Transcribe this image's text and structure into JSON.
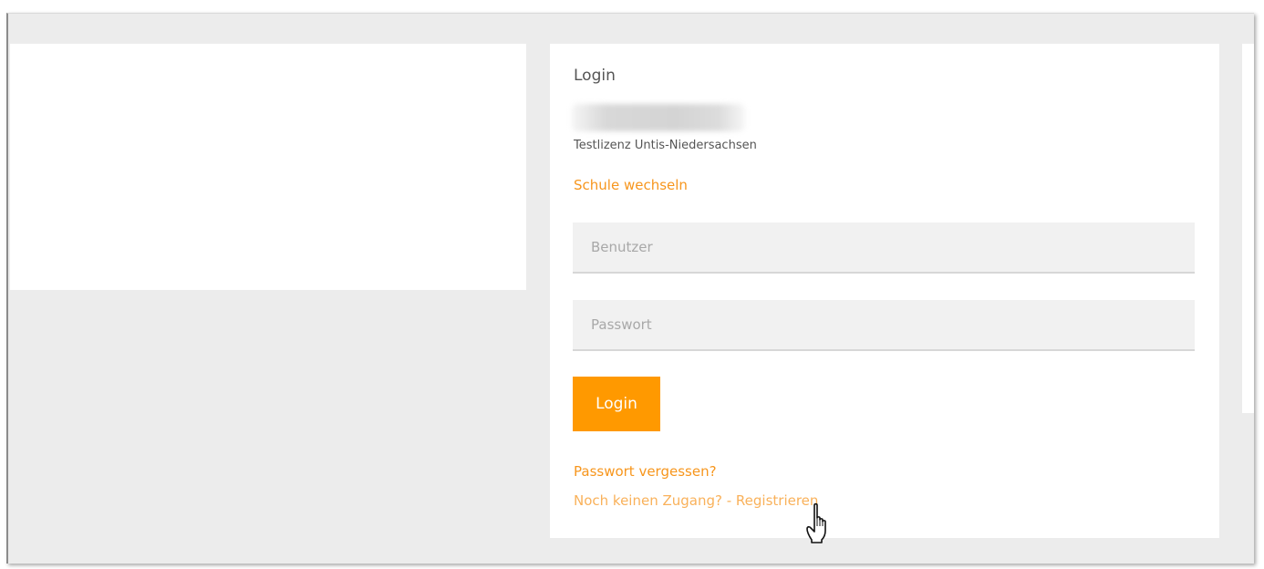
{
  "login": {
    "title": "Login",
    "license": "Testlizenz Untis-Niedersachsen",
    "change_school": "Schule wechseln",
    "username_placeholder": "Benutzer",
    "password_placeholder": "Passwort",
    "login_button": "Login",
    "forgot_password": "Passwort vergessen?",
    "register": "Noch keinen Zugang? - Registrieren"
  },
  "colors": {
    "accent": "#ff9900",
    "link": "#f7961d",
    "background": "#ececec"
  },
  "icons": {
    "cursor": "hand-pointer-icon"
  }
}
